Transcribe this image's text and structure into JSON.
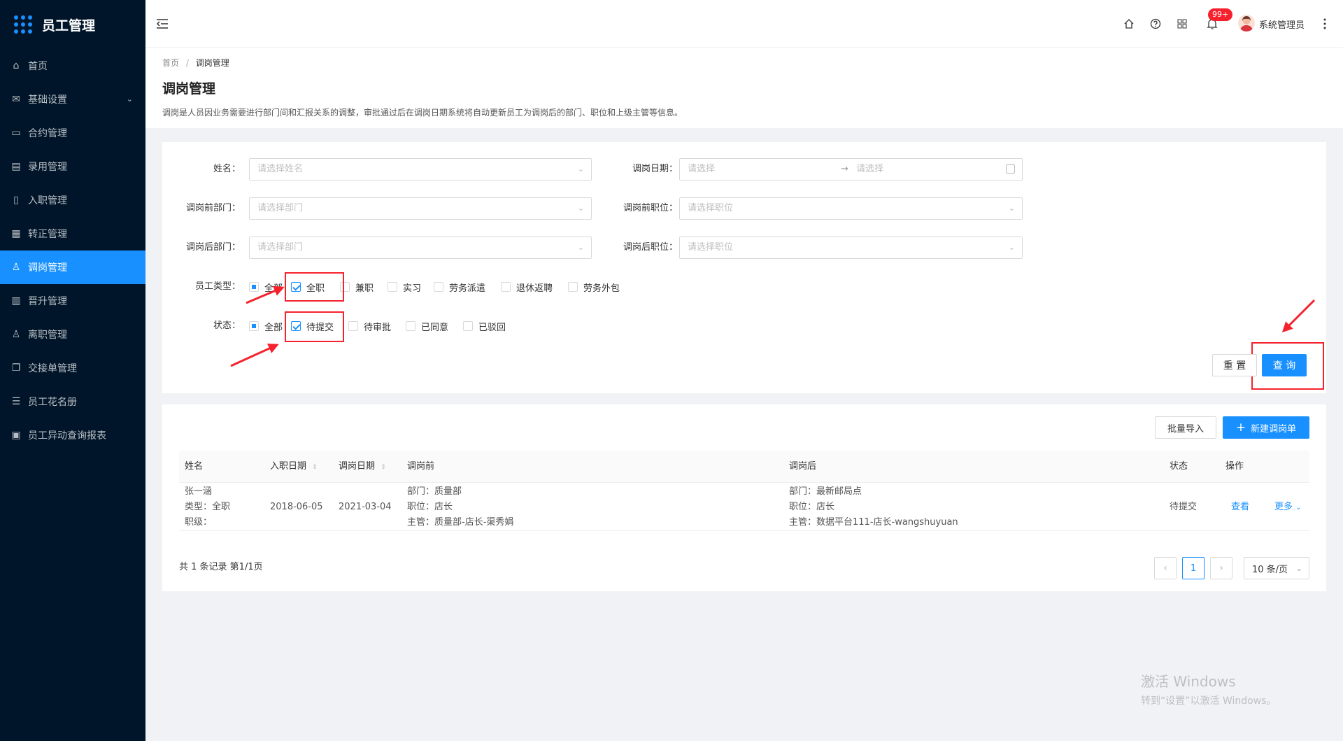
{
  "app": {
    "title": "员工管理"
  },
  "sidebar": {
    "items": [
      {
        "label": "首页",
        "icon": "home-icon"
      },
      {
        "label": "基础设置",
        "icon": "mail-icon"
      },
      {
        "label": "合约管理",
        "icon": "calendar-icon"
      },
      {
        "label": "录用管理",
        "icon": "book-icon"
      },
      {
        "label": "入职管理",
        "icon": "file-icon"
      },
      {
        "label": "转正管理",
        "icon": "grid-icon"
      },
      {
        "label": "调岗管理",
        "icon": "user-icon"
      },
      {
        "label": "晋升管理",
        "icon": "doc-icon"
      },
      {
        "label": "离职管理",
        "icon": "user-remove-icon"
      },
      {
        "label": "交接单管理",
        "icon": "copy-icon"
      },
      {
        "label": "员工花名册",
        "icon": "list-icon"
      },
      {
        "label": "员工异动查询报表",
        "icon": "report-icon"
      }
    ],
    "active_index": 6
  },
  "header": {
    "notification_count": "99+",
    "user_name": "系统管理员"
  },
  "breadcrumb": {
    "home": "首页",
    "separator": "/",
    "current": "调岗管理"
  },
  "page": {
    "title": "调岗管理",
    "description": "调岗是人员因业务需要进行部门间和汇报关系的调整，审批通过后在调岗日期系统将自动更新员工为调岗后的部门、职位和上级主管等信息。"
  },
  "filters": {
    "name_label": "姓名：",
    "name_placeholder": "请选择姓名",
    "date_label": "调岗日期：",
    "date_start_placeholder": "请选择",
    "date_end_placeholder": "请选择",
    "before_dept_label": "调岗前部门：",
    "before_dept_placeholder": "请选择部门",
    "before_pos_label": "调岗前职位：",
    "before_pos_placeholder": "请选择职位",
    "after_dept_label": "调岗后部门：",
    "after_dept_placeholder": "请选择部门",
    "after_pos_label": "调岗后职位：",
    "after_pos_placeholder": "请选择职位",
    "employee_type_label": "员工类型：",
    "employee_types": [
      {
        "label": "全部",
        "state": "indeterminate"
      },
      {
        "label": "全职",
        "state": "checked"
      },
      {
        "label": "兼职",
        "state": "unchecked"
      },
      {
        "label": "实习",
        "state": "unchecked"
      },
      {
        "label": "劳务派遣",
        "state": "unchecked"
      },
      {
        "label": "退休返聘",
        "state": "unchecked"
      },
      {
        "label": "劳务外包",
        "state": "unchecked"
      }
    ],
    "status_label": "状态：",
    "statuses": [
      {
        "label": "全部",
        "state": "indeterminate"
      },
      {
        "label": "待提交",
        "state": "checked"
      },
      {
        "label": "待审批",
        "state": "unchecked"
      },
      {
        "label": "已同意",
        "state": "unchecked"
      },
      {
        "label": "已驳回",
        "state": "unchecked"
      }
    ],
    "reset_label": "重 置",
    "query_label": "查 询"
  },
  "table": {
    "import_label": "批量导入",
    "new_label": "新建调岗单",
    "columns": {
      "name": "姓名",
      "join_date": "入职日期",
      "transfer_date": "调岗日期",
      "before": "调岗前",
      "after": "调岗后",
      "status": "状态",
      "actions": "操作"
    },
    "rows": [
      {
        "name": "张一涵",
        "type": "类型：全职",
        "level": "职级：",
        "join_date": "2018-06-05",
        "transfer_date": "2021-03-04",
        "before_dept": "部门：质量部",
        "before_pos": "职位：店长",
        "before_mgr": "主管：质量部-店长-渠秀娟",
        "after_dept": "部门：最新邮局点",
        "after_pos": "职位：店长",
        "after_mgr": "主管：数据平台111-店长-wangshuyuan",
        "status": "待提交",
        "view": "查看",
        "more": "更多"
      }
    ]
  },
  "pagination": {
    "summary": "共 1 条记录 第1/1页",
    "current_page": "1",
    "page_size": "10 条/页"
  },
  "watermark": {
    "line1": "激活 Windows",
    "line2": "转到“设置”以激活 Windows。"
  },
  "colors": {
    "primary": "#1890ff",
    "sidebar": "#001529",
    "annotation": "#f5222d"
  }
}
